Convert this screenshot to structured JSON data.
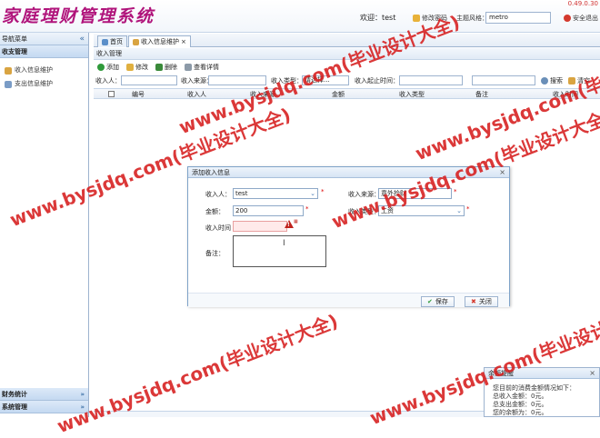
{
  "header": {
    "app_title": "家庭理财管理系统",
    "version_fragment": "0.49.0.30",
    "welcome_prefix": "欢迎：",
    "username": "test",
    "change_password": "修改密码",
    "theme_label": "主题风格：",
    "theme_value": "metro",
    "logout": "安全退出"
  },
  "sidebar": {
    "title": "导航菜单",
    "group": "收支管理",
    "items": [
      {
        "label": "收入信息维护",
        "icon": "income-icon"
      },
      {
        "label": "支出信息维护",
        "icon": "expense-icon"
      }
    ],
    "bottom_groups": [
      "财务统计",
      "系统管理"
    ]
  },
  "tabs": [
    {
      "label": "首页",
      "closable": false
    },
    {
      "label": "收入信息维护",
      "closable": true
    }
  ],
  "panel": {
    "title": "收入管理"
  },
  "toolbar": {
    "add": "添加",
    "edit": "修改",
    "delete": "删除",
    "view": "查看详情"
  },
  "search": {
    "income_person_label": "收入人：",
    "source_label": "收入来源：",
    "type_label": "收入类型：",
    "type_value": "请选择...",
    "time_label": "收入起止时间：",
    "search_button": "搜索",
    "clear_button": "清空"
  },
  "grid": {
    "columns": [
      "编号",
      "收入人",
      "收入来源",
      "金额",
      "收入类型",
      "备注",
      "收入时间"
    ],
    "rows": []
  },
  "dialog": {
    "title": "添加收入信息",
    "fields": {
      "person_label": "收入人：",
      "person_value": "test",
      "source_label": "收入来源：",
      "source_value": "意外捡财",
      "amount_label": "金额：",
      "amount_value": "200",
      "type_label": "收入类型：",
      "type_value": "工资",
      "time_label": "收入时间",
      "time_value": "",
      "remark_label": "备注：",
      "remark_value": ""
    },
    "save_button": "保存",
    "cancel_button": "关闭"
  },
  "notify": {
    "title": "余额提醒",
    "lines": [
      "您目前的消费金额情况如下：",
      "总收入金额：0元。",
      "总支出金额：0元。",
      "您的余额为：0元。"
    ]
  },
  "watermark": {
    "text": "www.bysjdq.com(毕业设计大全)"
  },
  "colors": {
    "title": "#b0147b",
    "watermark": "#d61c1c",
    "border": "#9db3cf",
    "required": "#dd0000"
  }
}
